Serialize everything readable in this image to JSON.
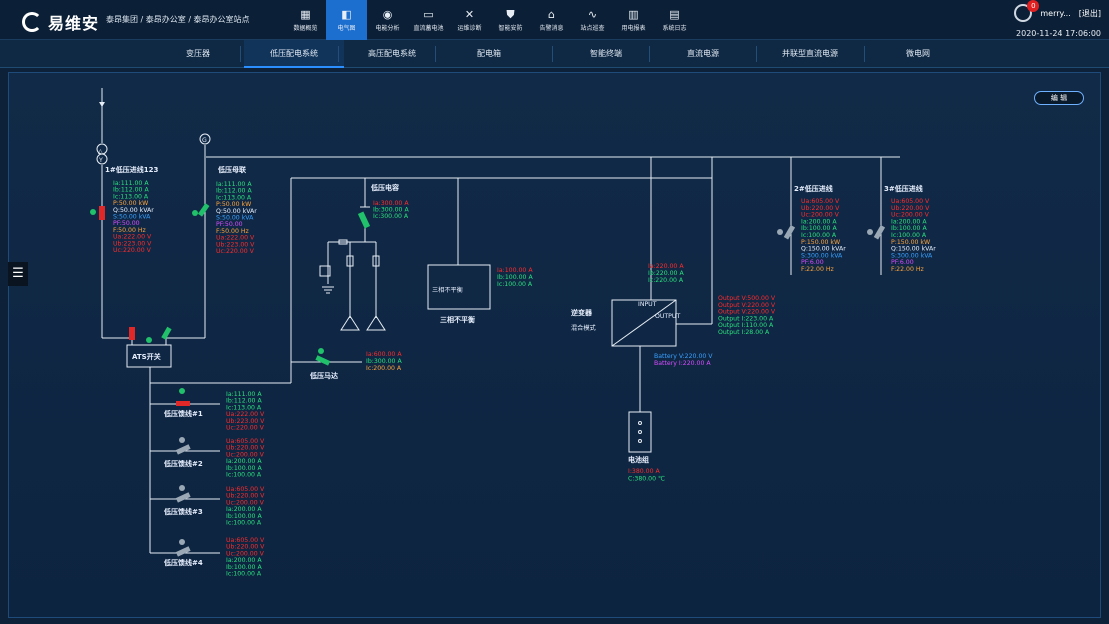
{
  "app": {
    "brand": "易维安",
    "breadcrumb": "泰昂集团 / 泰昂办公室 / 泰昂办公室站点"
  },
  "menu": [
    {
      "label": "数据概览",
      "icon": "grid-icon"
    },
    {
      "label": "电气图",
      "icon": "diagram-icon",
      "active": true
    },
    {
      "label": "电能分析",
      "icon": "gauge-icon"
    },
    {
      "label": "直流蓄电池",
      "icon": "battery-icon"
    },
    {
      "label": "运维诊断",
      "icon": "tools-icon"
    },
    {
      "label": "智能安防",
      "icon": "shield-icon"
    },
    {
      "label": "告警消息",
      "icon": "bank-icon"
    },
    {
      "label": "站点巡查",
      "icon": "pulse-icon"
    },
    {
      "label": "用电报表",
      "icon": "bar-chart-icon"
    },
    {
      "label": "系统日志",
      "icon": "log-icon"
    }
  ],
  "user": {
    "name": "merry...",
    "logout": "[退出]",
    "badge": "0",
    "datetime": "2020-11-24 17:06:00"
  },
  "tabs": [
    "变压器",
    "低压配电系统",
    "高压配电系统",
    "配电箱",
    "智能终端",
    "直流电源",
    "并联型直流电源",
    "微电网"
  ],
  "active_tab": 1,
  "edit_label": "编 辑",
  "diagram": {
    "in1": {
      "title": "1#低压进线123",
      "lines": [
        "Ia:111.00 A",
        "Ib:112.00 A",
        "Ic:113.00 A",
        "P:50.00 kW",
        "Q:50.00 kVAr",
        "S:50.00 kVA",
        "PF:50.00",
        "F:50.00 Hz",
        "Ua:222.00 V",
        "Ub:223.00 V",
        "Uc:220.00 V"
      ]
    },
    "tie": {
      "title": "低压母联",
      "lines": [
        "Ia:111.00 A",
        "Ib:112.00 A",
        "Ic:113.00 A",
        "P:50.00 kW",
        "Q:50.00 kVAr",
        "S:50.00 kVA",
        "PF:50.00",
        "F:50.00 Hz",
        "Ua:222.00 V",
        "Ub:223.00 V",
        "Uc:220.00 V"
      ]
    },
    "cap": {
      "title": "低压电容",
      "lines": [
        "Ia:300.00 A",
        "Ib:300.00 A",
        "Ic:300.00 A"
      ]
    },
    "unb": {
      "box": "三相不平衡",
      "title": "三相不平衡",
      "lines": [
        "Ia:100.00 A",
        "Ib:100.00 A",
        "Ic:100.00 A"
      ]
    },
    "inv": {
      "title": "逆变器",
      "mode": "混合模式",
      "in_label": "INPUT",
      "out_label": "OUTPUT",
      "in_lines": [
        "Ia:220.00 A",
        "Ib:220.00 A",
        "Ic:220.00 A"
      ],
      "out_lines": [
        "Output V:500.00 V",
        "Output V:220.00 V",
        "Output V:220.00 V",
        "Output I:223.00 A",
        "Output I:110.00 A",
        "Output I:28.00 A"
      ],
      "bat_lines": [
        "Battery V:220.00 V",
        "Battery I:220.00 A"
      ]
    },
    "battery": {
      "title": "电池组",
      "lines": [
        "I:380.00 A",
        "C:380.00 ℃"
      ]
    },
    "in2": {
      "title": "2#低压进线",
      "lines": [
        "Ua:605.00 V",
        "Ub:220.00 V",
        "Uc:200.00 V",
        "Ia:200.00 A",
        "Ib:100.00 A",
        "Ic:100.00 A",
        "P:150.00 kW",
        "Q:150.00 kVAr",
        "S:300.00 kVA",
        "PF:6.00",
        "F:22.00 Hz"
      ]
    },
    "in3": {
      "title": "3#低压进线",
      "lines": [
        "Ua:605.00 V",
        "Ub:220.00 V",
        "Uc:200.00 V",
        "Ia:200.00 A",
        "Ib:100.00 A",
        "Ic:100.00 A",
        "P:150.00 kW",
        "Q:150.00 kVAr",
        "S:300.00 kVA",
        "PF:6.00",
        "F:22.00 Hz"
      ]
    },
    "motor": {
      "title": "低压马达",
      "lines": [
        "Ia:600.00 A",
        "Ib:300.00 A",
        "Ic:200.00 A"
      ]
    },
    "ats": {
      "title": "ATS开关"
    },
    "f1": {
      "title": "低压馈线#1",
      "lines": [
        "Ia:111.00 A",
        "Ib:112.00 A",
        "Ic:113.00 A",
        "Ua:222.00 V",
        "Ub:223.00 V",
        "Uc:220.00 V"
      ]
    },
    "f2": {
      "title": "低压馈线#2",
      "lines": [
        "Ua:605.00 V",
        "Ub:220.00 V",
        "Uc:200.00 V",
        "Ia:200.00 A",
        "Ib:100.00 A",
        "Ic:100.00 A"
      ]
    },
    "f3": {
      "title": "低压馈线#3",
      "lines": [
        "Ua:605.00 V",
        "Ub:220.00 V",
        "Uc:200.00 V",
        "Ia:200.00 A",
        "Ib:100.00 A",
        "Ic:100.00 A"
      ]
    },
    "f4": {
      "title": "低压馈线#4",
      "lines": [
        "Ua:605.00 V",
        "Ub:220.00 V",
        "Uc:200.00 V",
        "Ia:200.00 A",
        "Ib:100.00 A",
        "Ic:100.00 A"
      ]
    }
  }
}
